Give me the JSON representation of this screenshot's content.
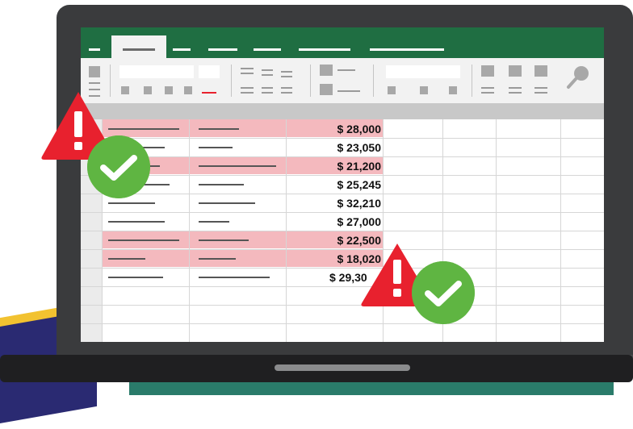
{
  "spreadsheet": {
    "amounts": [
      "$ 28,000",
      "$ 23,050",
      "$ 21,200",
      "$ 25,245",
      "$ 32,210",
      "$ 27,000",
      "$ 22,500",
      "$ 18,020",
      "$ 29,30"
    ]
  },
  "highlighted_rows": [
    0,
    2,
    6,
    7
  ],
  "colors": {
    "ribbon_green": "#1f6e42",
    "highlight_red": "#f4b9be",
    "warning_red": "#e8212e",
    "check_green": "#5fb542"
  },
  "icons": [
    "warning-icon",
    "checkmark-icon",
    "search-icon"
  ]
}
